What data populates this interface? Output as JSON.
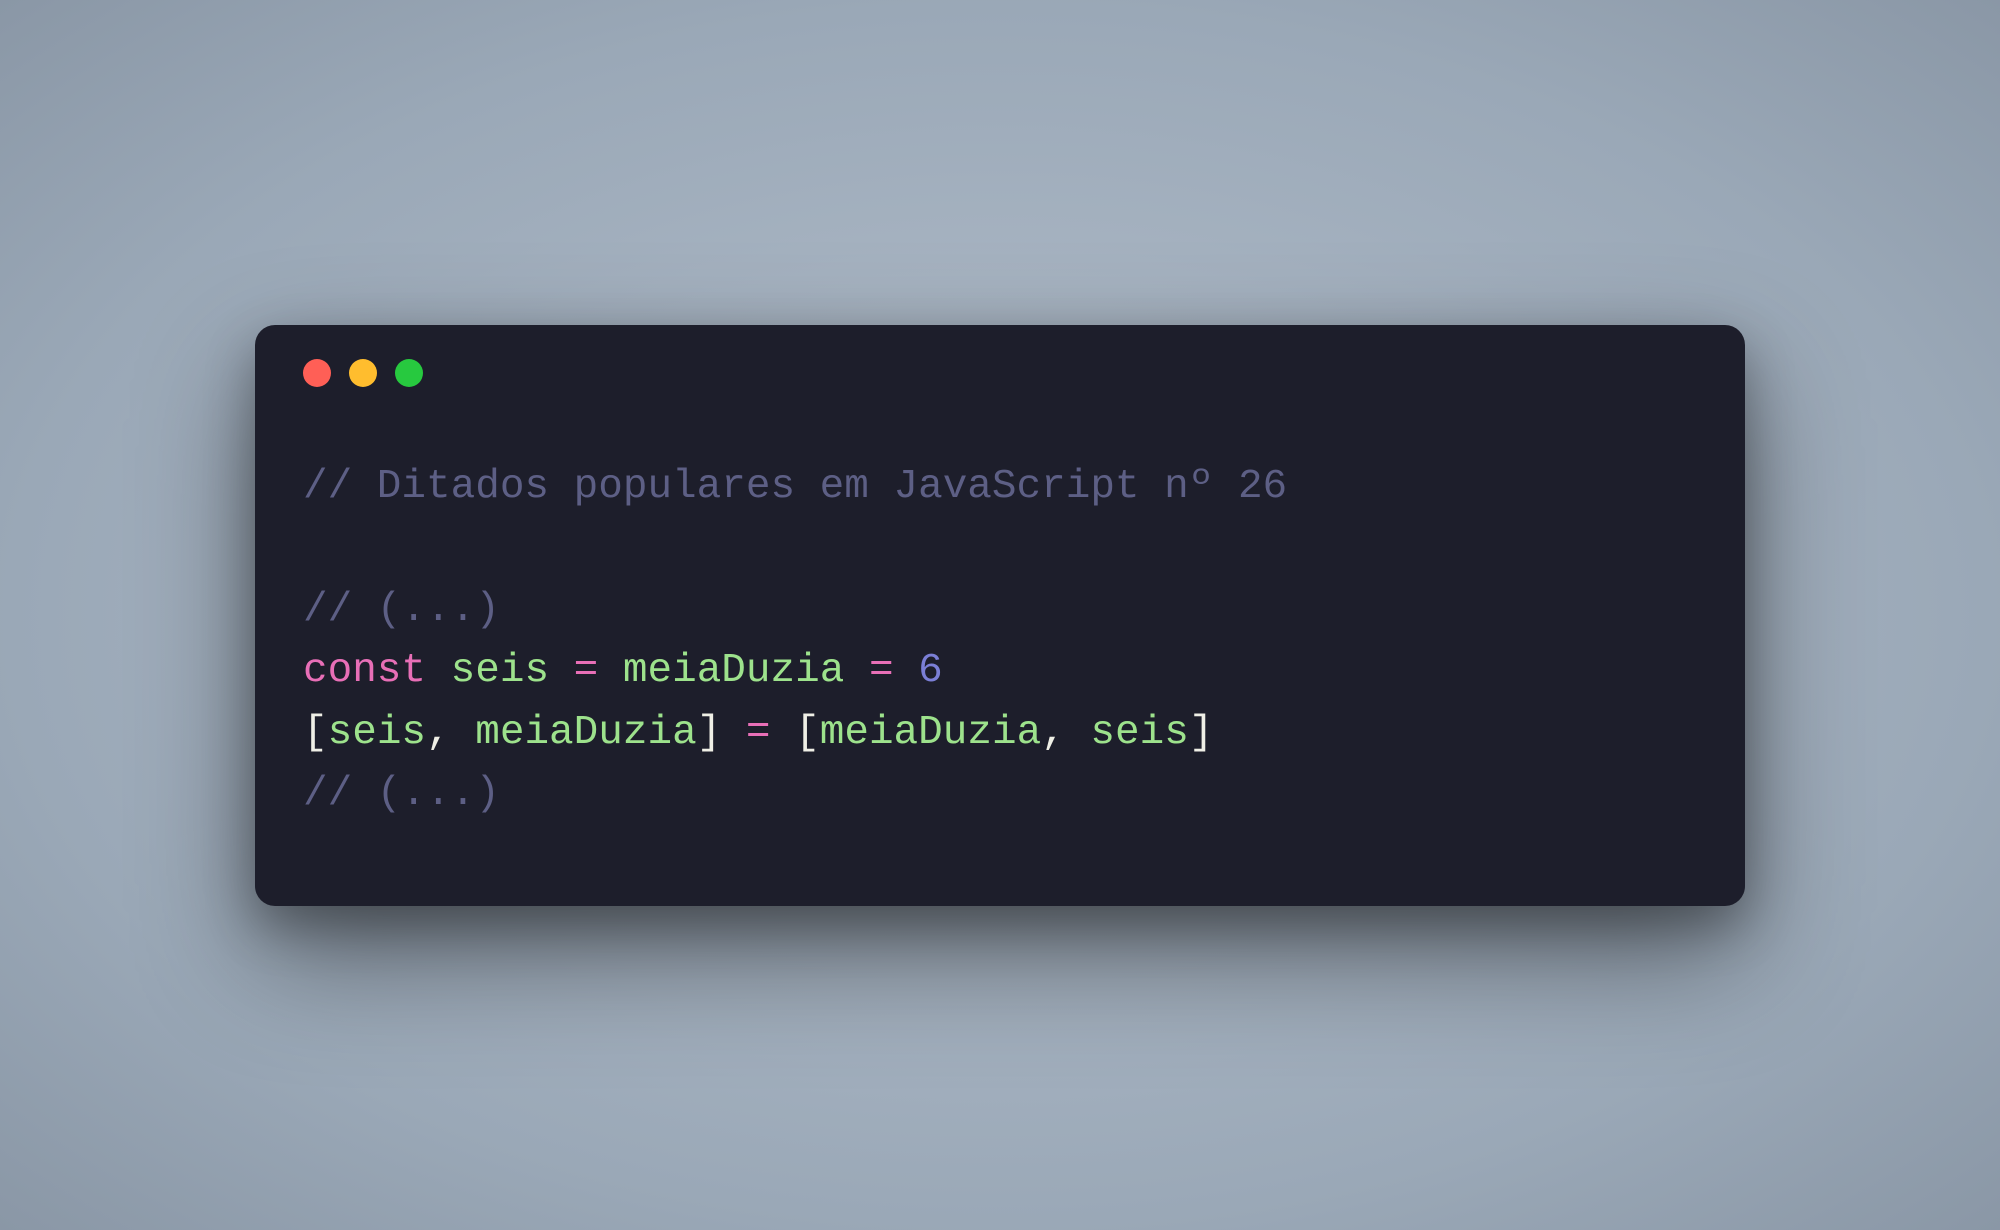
{
  "colors": {
    "background_outer": "#a7b3c1",
    "window_bg": "#1d1e2b",
    "comment": "#5d5f85",
    "keyword": "#e86fb7",
    "variable": "#9de28c",
    "operator": "#e86fb7",
    "number": "#7b7fd6",
    "bracket": "#efefe6",
    "traffic_red": "#ff5f56",
    "traffic_yellow": "#ffbd2e",
    "traffic_green": "#27c93f"
  },
  "code": {
    "line1_comment": "// Ditados populares em JavaScript nº 26",
    "line3_comment": "// (...)",
    "line4": {
      "keyword": "const",
      "space1": " ",
      "var1": "seis",
      "space2": " ",
      "op1": "=",
      "space3": " ",
      "var2": "meiaDuzia",
      "space4": " ",
      "op2": "=",
      "space5": " ",
      "number": "6"
    },
    "line5": {
      "lb1": "[",
      "var1": "seis",
      "comma1": ",",
      "space1": " ",
      "var2": "meiaDuzia",
      "rb1": "]",
      "space2": " ",
      "op": "=",
      "space3": " ",
      "lb2": "[",
      "var3": "meiaDuzia",
      "comma2": ",",
      "space4": " ",
      "var4": "seis",
      "rb2": "]"
    },
    "line6_comment": "// (...)"
  }
}
